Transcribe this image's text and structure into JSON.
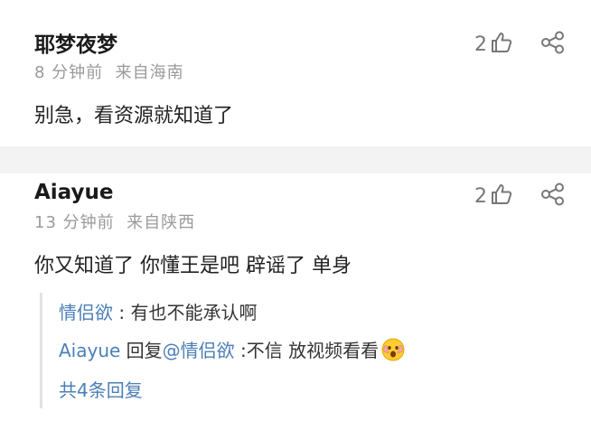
{
  "comments": [
    {
      "username": "耶梦夜梦",
      "time": "8 分钟前",
      "location": "来自海南",
      "text": "别急，看资源就知道了",
      "likes": "2"
    },
    {
      "username": "Aiayue",
      "time": "13 分钟前",
      "location": "来自陕西",
      "text": "你又知道了 你懂王是吧 辟谣了 单身",
      "likes": "2",
      "replies": [
        {
          "user": "情侣欲",
          "sep": " : ",
          "text": "有也不能承认啊"
        },
        {
          "user": "Aiayue",
          "reply_word": " 回复",
          "mention": "@情侣欲",
          "sep": " :",
          "text": "不信 放视频看看"
        }
      ],
      "more_replies": "共4条回复"
    }
  ],
  "colors": {
    "link": "#4b7fb7",
    "meta": "#9a9a9a",
    "divider": "#f3f3f3"
  },
  "icons": {
    "like": "thumbs-up-icon",
    "share": "share-icon",
    "emoji": "face-emoji-icon"
  }
}
